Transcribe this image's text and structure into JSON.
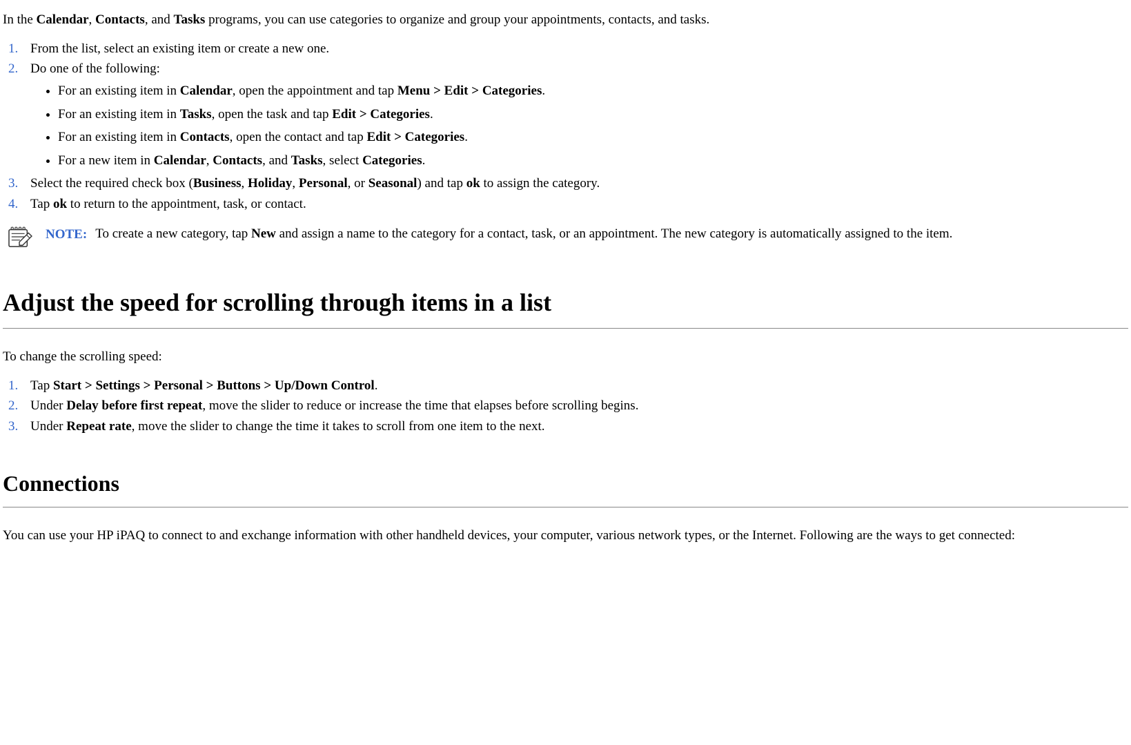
{
  "intro": {
    "before_calendar": "In the ",
    "app1": "Calendar",
    "sep1": ", ",
    "app2": "Contacts",
    "sep2": ", and ",
    "app3": "Tasks",
    "after_apps": " programs, you can use categories to organize and group your appointments, contacts, and tasks."
  },
  "steps1": {
    "s1": "From the list, select an existing item or create a new one.",
    "s2": "Do one of the following:",
    "bullets": {
      "b1_pre": "For an existing item in ",
      "b1_app": "Calendar",
      "b1_mid": ", open the appointment and tap ",
      "b1_cmd": "Menu > Edit > Categories",
      "b1_end": ".",
      "b2_pre": "For an existing item in ",
      "b2_app": "Tasks",
      "b2_mid": ", open the task and tap ",
      "b2_cmd": "Edit > Categories",
      "b2_end": ".",
      "b3_pre": "For an existing item in ",
      "b3_app": "Contacts",
      "b3_mid": ", open the contact and tap ",
      "b3_cmd": "Edit > Categories",
      "b3_end": ".",
      "b4_pre": "For a new item in ",
      "b4_a1": "Calendar",
      "b4_sep1": ", ",
      "b4_a2": "Contacts",
      "b4_sep2": ", and ",
      "b4_a3": "Tasks",
      "b4_mid": ", select ",
      "b4_cmd": "Categories",
      "b4_end": "."
    },
    "s3_pre": "Select the required check box (",
    "s3_b1": "Business",
    "s3_c1": ", ",
    "s3_b2": "Holiday",
    "s3_c2": ", ",
    "s3_b3": "Personal",
    "s3_c3": ", or ",
    "s3_b4": "Seasonal",
    "s3_mid": ") and tap ",
    "s3_ok": "ok",
    "s3_end": " to assign the category.",
    "s4_pre": "Tap ",
    "s4_ok": "ok",
    "s4_end": " to return to the appointment, task, or contact."
  },
  "note": {
    "label": "NOTE:",
    "body_pre": "To create a new category, tap ",
    "body_new": "New",
    "body_post": " and assign a name to the category for a contact, task, or an appointment. The new category is automatically assigned to the item."
  },
  "section2": {
    "title": "Adjust the speed for scrolling through items in a list",
    "intro": "To change the scrolling speed:",
    "s1_pre": "Tap ",
    "s1_cmd": "Start > Settings > Personal > Buttons > Up/Down Control",
    "s1_end": ".",
    "s2_pre": "Under ",
    "s2_b": "Delay before first repeat",
    "s2_end": ", move the slider to reduce or increase the time that elapses before scrolling begins.",
    "s3_pre": "Under ",
    "s3_b": "Repeat rate",
    "s3_end": ", move the slider to change the time it takes to scroll from one item to the next."
  },
  "section3": {
    "title": "Connections",
    "intro": "You can use your HP iPAQ to connect to and exchange information with other handheld devices, your computer, various network types, or the Internet. Following are the ways to get connected:"
  }
}
